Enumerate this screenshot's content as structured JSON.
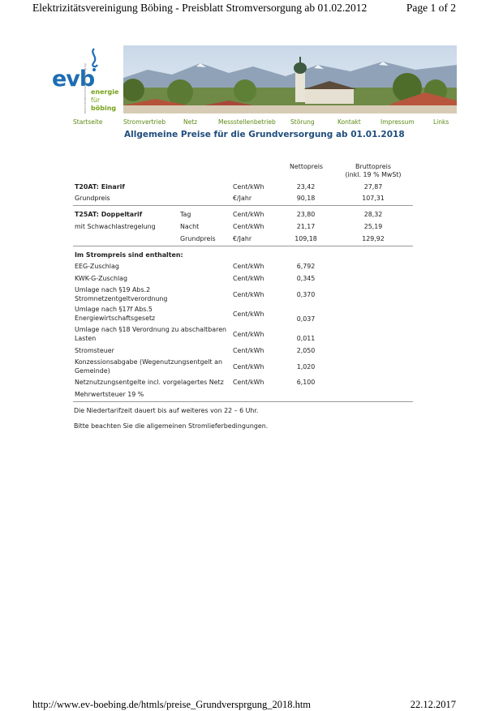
{
  "print_header": {
    "title": "Elektrizitätsvereinigung Böbing - Preisblatt Stromversorgung ab 01.02.2012",
    "page": "Page 1 of 2"
  },
  "print_footer": {
    "url": "http://www.ev-boebing.de/htmls/preise_Grundversprgung_2018.htm",
    "date": "22.12.2017"
  },
  "logo": {
    "mark": "evb",
    "line1": "energie",
    "line2": "für",
    "line3": "böbing",
    "vertical_text": "elektrizitätsvereinigung böbing eg"
  },
  "nav": [
    "Startseite",
    "Stromvertrieb",
    "Netz",
    "Messstellenbetrieb",
    "Störung",
    "Kontakt",
    "Impressum",
    "Links"
  ],
  "colors": {
    "nav": "#5c8a14",
    "title": "#1f4d7d",
    "logo_blue": "#1d6db3",
    "logo_green": "#77a21a"
  },
  "title": "Allgemeine Preise für die Grundversorgung ab 01.01.2018",
  "table": {
    "head_net": "Nettopreis",
    "head_gross": "Bruttopreis",
    "head_gross_sub": "(inkl. 19 % MwSt)",
    "t20": {
      "name": "T20AT: Einarif",
      "rows": [
        {
          "label": "",
          "unit": "Cent/kWh",
          "net": "23,42",
          "gross": "27,87"
        },
        {
          "label": "Grundpreis",
          "unit": "€/Jahr",
          "net": "90,18",
          "gross": "107,31"
        }
      ]
    },
    "t25": {
      "name": "T25AT: Doppeltarif",
      "sub": "mit Schwachlastregelung",
      "rows": [
        {
          "label": "Tag",
          "unit": "Cent/kWh",
          "net": "23,80",
          "gross": "28,32"
        },
        {
          "label": "Nacht",
          "unit": "Cent/kWh",
          "net": "21,17",
          "gross": "25,19"
        },
        {
          "label": "Grundpreis",
          "unit": "€/Jahr",
          "net": "109,18",
          "gross": "129,92"
        }
      ]
    },
    "included_heading": "Im Strompreis sind enthalten:",
    "included": [
      {
        "l1": "EEG-Zuschlag",
        "l2": "",
        "unit": "Cent/kWh",
        "val": "6,792"
      },
      {
        "l1": "KWK-G-Zuschlag",
        "l2": "",
        "unit": "Cent/kWh",
        "val": "0,345"
      },
      {
        "l1": "Umlage nach §19 Abs.2",
        "l2": "Stromnetzentgeltverordnung",
        "unit": "Cent/kWh",
        "val": "0,370"
      },
      {
        "l1": "Umlage nach §17f Abs.5",
        "l2": "Energiewirtschaftsgesetz",
        "unit": "Cent/kWh",
        "val": "0,037"
      },
      {
        "l1": "Umlage nach §18 Verordnung zu abschaltbaren",
        "l2": "Lasten",
        "unit": "Cent/kWh",
        "val": "0,011"
      },
      {
        "l1": "Stromsteuer",
        "l2": "",
        "unit": "Cent/kWh",
        "val": "2,050"
      },
      {
        "l1": "Konzessionsabgabe (Wegenutzungsentgelt an",
        "l2": "Gemeinde)",
        "unit": "Cent/kWh",
        "val": "1,020"
      },
      {
        "l1": "Netznutzungsentgelte incl. vorgelagertes Netz",
        "l2": "",
        "unit": "Cent/kWh",
        "val": "6,100"
      },
      {
        "l1": "Mehrwertsteuer 19 %",
        "l2": "",
        "unit": "",
        "val": ""
      }
    ]
  },
  "notes": [
    "Die Niedertarifzeit dauert bis auf weiteres von 22 – 6 Uhr.",
    "Bitte beachten Sie die allgemeinen Stromlieferbedingungen."
  ]
}
